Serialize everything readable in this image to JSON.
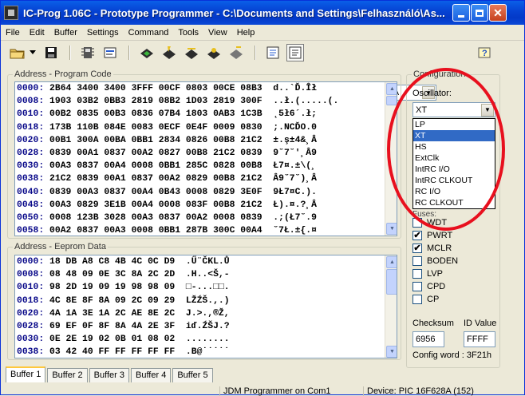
{
  "window": {
    "title": "IC-Prog 1.06C - Prototype Programmer - C:\\Documents and Settings\\Felhasználó\\As..."
  },
  "menu": [
    "File",
    "Edit",
    "Buffer",
    "Settings",
    "Command",
    "Tools",
    "View",
    "Help"
  ],
  "toolbar": {
    "icons": [
      "open-folder-icon",
      "dropdown-arrow-icon",
      "save-disk-icon",
      "chip-config-icon",
      "settings-icon",
      "read-chip-icon",
      "program-chip-icon",
      "erase-chip-icon",
      "verify-chip-icon",
      "blank-check-icon",
      "view-buffer-icon",
      "view-hex-icon",
      "help-icon"
    ],
    "device": "PIC 16F628A"
  },
  "program_code": {
    "title": "Address - Program Code",
    "rows": [
      {
        "addr": "0000:",
        "hex": "2B64 3400 3400 3FFF 00CF 0803 00CE 08B3",
        "ascii": "d..`Ď.Îł"
      },
      {
        "addr": "0008:",
        "hex": "1903 03B2 0BB3 2819 08B2 1D03 2819 300F",
        "ascii": "..ł.(.....(."
      },
      {
        "addr": "0010:",
        "hex": "00B2 0835 00B3 0836 07B4 1803 0AB3 1C3B",
        "ascii": "˛5ł6´.ł;"
      },
      {
        "addr": "0018:",
        "hex": "173B 110B 084E 0083 0ECF 0E4F 0009 0830",
        "ascii": ";.NCĎO.0"
      },
      {
        "addr": "0020:",
        "hex": "00B1 300A 00BA 0BB1 2834 0826 00B8 21C2",
        "ascii": "±.ş±4&¸Â"
      },
      {
        "addr": "0028:",
        "hex": "0839 00A1 0837 00A2 0827 00B8 21C2 0839",
        "ascii": "9˘7˘'¸Â9"
      },
      {
        "addr": "0030:",
        "hex": "00A3 0837 00A4 0008 0BB1 285C 0828 00B8",
        "ascii": "Ł7¤.±\\(¸"
      },
      {
        "addr": "0038:",
        "hex": "21C2 0839 00A1 0837 00A2 0829 00B8 21C2",
        "ascii": "Â9˘7˘)¸Â"
      },
      {
        "addr": "0040:",
        "hex": "0839 00A3 0837 00A4 0B43 0008 0829 3E0F",
        "ascii": "9Ł7¤C.)."
      },
      {
        "addr": "0048:",
        "hex": "00A3 0829 3E1B 00A4 0008 083F 00B8 21C2",
        "ascii": "Ł).¤.?¸Â"
      },
      {
        "addr": "0050:",
        "hex": "0008 123B 3028 00A3 0837 00A2 0008 0839",
        "ascii": ".;(Ł7˘.9"
      },
      {
        "addr": "0058:",
        "hex": "00A2 0837 00A3 0008 0BB1 287B 300C 00A4",
        "ascii": "˘7Ł.±{.¤"
      }
    ]
  },
  "eeprom": {
    "title": "Address - Eeprom Data",
    "rows": [
      {
        "addr": "0000:",
        "hex": "18 DB A8 C8 4B 4C 0C D9",
        "ascii": ".Ű¨ČKL.Ů"
      },
      {
        "addr": "0008:",
        "hex": "08 48 09 0E 3C 8A 2C 2D",
        "ascii": ".H..<Š,-"
      },
      {
        "addr": "0010:",
        "hex": "98 2D 19 09 19 98 98 09",
        "ascii": "□-...□□."
      },
      {
        "addr": "0018:",
        "hex": "4C 8E 8F 8A 09 2C 09 29",
        "ascii": "LŽŹŠ.,.)"
      },
      {
        "addr": "0020:",
        "hex": "4A 1A 3E 1A 2C AE 8E 2C",
        "ascii": "J.>.,®Ž,"
      },
      {
        "addr": "0028:",
        "hex": "69 EF 0F 8F 8A 4A 2E 3F",
        "ascii": "iď.ŹŠJ.?"
      },
      {
        "addr": "0030:",
        "hex": "0E 2E 19 02 0B 01 08 02",
        "ascii": "........"
      },
      {
        "addr": "0038:",
        "hex": "03 42 40 FF FF FF FF FF",
        "ascii": ".B@˙˙˙˙˙"
      }
    ]
  },
  "tabs": [
    "Buffer 1",
    "Buffer 2",
    "Buffer 3",
    "Buffer 4",
    "Buffer 5"
  ],
  "status": {
    "left": "",
    "programmer": "JDM Programmer on Com1",
    "device": "Device: PIC 16F628A  (152)"
  },
  "config": {
    "title": "Configuration",
    "oscillator_label": "Oscillator:",
    "oscillator_value": "XT",
    "oscillator_options": [
      "LP",
      "XT",
      "HS",
      "ExtClk",
      "IntRC I/O",
      "IntRC CLKOUT",
      "RC I/O",
      "RC CLKOUT"
    ],
    "oscillator_selected_index": 1,
    "partial_label": "Fuses:",
    "fuses": [
      {
        "label": "WDT",
        "checked": false
      },
      {
        "label": "PWRT",
        "checked": true
      },
      {
        "label": "MCLR",
        "checked": true
      },
      {
        "label": "BODEN",
        "checked": false
      },
      {
        "label": "LVP",
        "checked": false
      },
      {
        "label": "CPD",
        "checked": false
      },
      {
        "label": "CP",
        "checked": false
      }
    ],
    "checksum_label": "Checksum",
    "checksum_value": "6956",
    "id_label": "ID Value",
    "id_value": "FFFF",
    "config_word": "Config word : 3F21h"
  }
}
